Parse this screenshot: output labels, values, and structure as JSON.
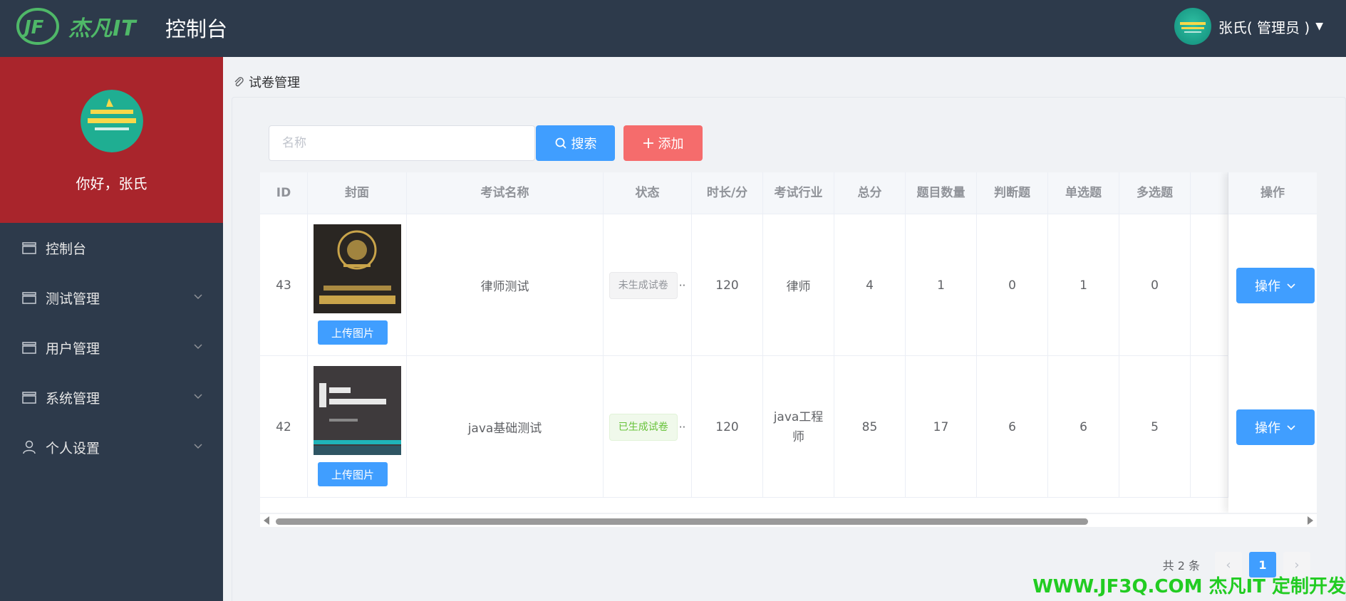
{
  "header": {
    "logo_text": "杰凡IT",
    "title": "控制台",
    "user_label": "张氏( 管理员 )"
  },
  "sidebar": {
    "greeting": "你好，张氏",
    "items": [
      {
        "label": "控制台",
        "icon": "tray-icon",
        "has_arrow": false
      },
      {
        "label": "测试管理",
        "icon": "tray-icon",
        "has_arrow": true
      },
      {
        "label": "用户管理",
        "icon": "tray-icon",
        "has_arrow": true
      },
      {
        "label": "系统管理",
        "icon": "tray-icon",
        "has_arrow": true
      },
      {
        "label": "个人设置",
        "icon": "user-icon",
        "has_arrow": true
      }
    ]
  },
  "breadcrumb": {
    "label": "试卷管理"
  },
  "search": {
    "placeholder": "名称",
    "search_label": "搜索",
    "add_label": "添加"
  },
  "table": {
    "columns": [
      "ID",
      "封面",
      "考试名称",
      "状态",
      "时长/分",
      "考试行业",
      "总分",
      "题目数量",
      "判断题",
      "单选题",
      "多选题",
      "",
      "操作"
    ],
    "rows": [
      {
        "id": "43",
        "upload_label": "上传图片",
        "name": "律师测试",
        "status": "未生成试卷",
        "duration": "120",
        "industry": "律师",
        "total": "4",
        "count": "1",
        "judge": "0",
        "single": "1",
        "multi": "0",
        "op_label": "操作"
      },
      {
        "id": "42",
        "upload_label": "上传图片",
        "name": "java基础测试",
        "status": "已生成试卷",
        "duration": "120",
        "industry": "java工程师",
        "total": "85",
        "count": "17",
        "judge": "6",
        "single": "6",
        "multi": "5",
        "op_label": "操作"
      }
    ]
  },
  "pagination": {
    "total_label": "共 2 条",
    "current_page": "1"
  },
  "footer_watermark": "WWW.JF3Q.COM 杰凡IT  定制开发",
  "colors": {
    "header_bg": "#2d3a4b",
    "profile_bg": "#a9252c",
    "primary": "#409eff",
    "danger": "#f56c6c",
    "success": "#67c23a",
    "watermark_green": "#22cc22"
  }
}
